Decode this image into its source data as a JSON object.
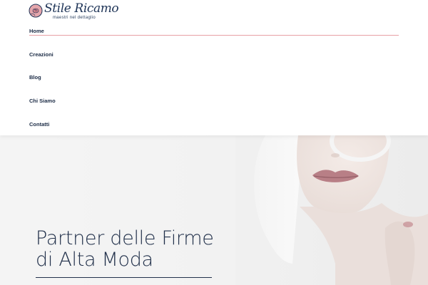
{
  "brand": {
    "name": "Stile Ricamo",
    "tagline": "maestri nel dettaglio",
    "colors": {
      "navy": "#1e3457",
      "accent": "#e8a0a4"
    }
  },
  "nav": {
    "items": [
      {
        "label": "Home",
        "active": true
      },
      {
        "label": "Creazioni",
        "active": false
      },
      {
        "label": "Blog",
        "active": false
      },
      {
        "label": "Chi Siamo",
        "active": false
      },
      {
        "label": "Contatti",
        "active": false
      }
    ]
  },
  "hero": {
    "title_line1": "Partner delle Firme",
    "title_line2": "di Alta Moda"
  }
}
